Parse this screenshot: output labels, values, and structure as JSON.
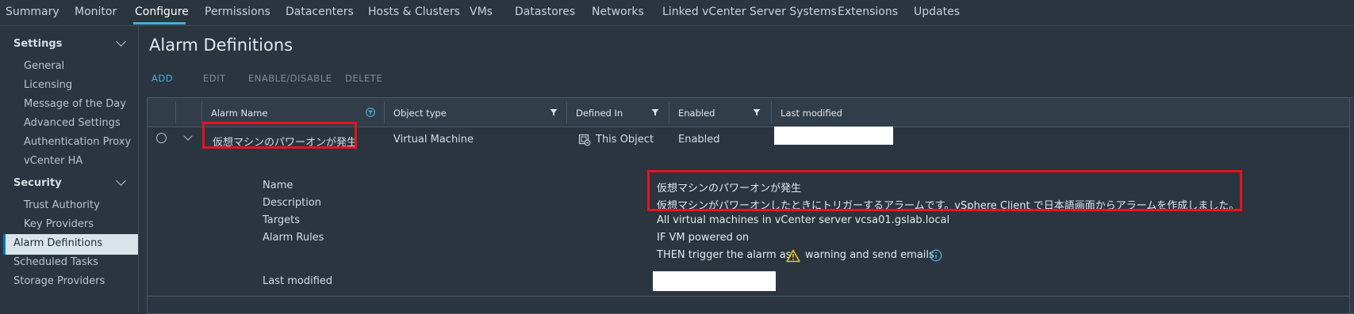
{
  "tabs": [
    "Summary",
    "Monitor",
    "Configure",
    "Permissions",
    "Datacenters",
    "Hosts & Clusters",
    "VMs",
    "Datastores",
    "Networks",
    "Linked vCenter Server Systems",
    "Extensions",
    "Updates"
  ],
  "active_tab": "Configure",
  "sidebar": {
    "settings_label": "Settings",
    "settings_items": [
      "General",
      "Licensing",
      "Message of the Day",
      "Advanced Settings",
      "Authentication Proxy",
      "vCenter HA"
    ],
    "security_label": "Security",
    "security_items": [
      "Trust Authority",
      "Key Providers"
    ],
    "other_items": [
      "Alarm Definitions",
      "Scheduled Tasks",
      "Storage Providers"
    ],
    "selected": "Alarm Definitions"
  },
  "main": {
    "title": "Alarm Definitions",
    "actions": {
      "add": "ADD",
      "edit": "EDIT",
      "enable_disable": "ENABLE/DISABLE",
      "delete": "DELETE"
    }
  },
  "grid": {
    "columns": {
      "name": "Alarm Name",
      "object_type": "Object type",
      "defined_in": "Defined In",
      "enabled": "Enabled",
      "last_modified": "Last modified"
    },
    "row": {
      "name": "仮想マシンのパワーオンが発生",
      "object_type": "Virtual Machine",
      "defined_in": "This Object",
      "enabled": "Enabled"
    },
    "details": {
      "name_label": "Name",
      "name_value": "仮想マシンのパワーオンが発生",
      "description_label": "Description",
      "description_value": "仮想マシンがパワーオンしたときにトリガーするアラームです。vSphere Client で日本語画面からアラームを作成しました。",
      "targets_label": "Targets",
      "targets_value": "All virtual machines in vCenter server vcsa01.gslab.local",
      "rules_label": "Alarm Rules",
      "rule_if": "IF VM powered on",
      "rule_then_prefix": "THEN trigger the alarm as",
      "rule_then_suffix": "warning and send emails",
      "last_modified_label": "Last modified"
    }
  },
  "colors": {
    "accent": "#49afd9",
    "highlight": "#e5141e",
    "warning": "#f5c518"
  }
}
